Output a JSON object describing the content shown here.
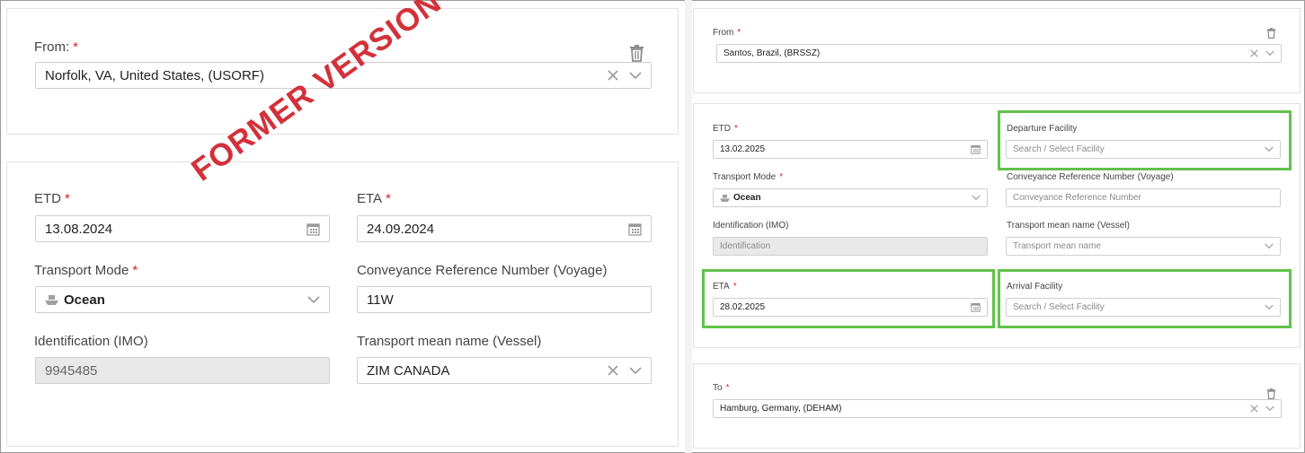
{
  "former": {
    "stamp": "FORMER VERSION",
    "from": {
      "label": "From:",
      "value": "Norfolk, VA, United States, (USORF)"
    },
    "etd": {
      "label": "ETD",
      "value": "13.08.2024"
    },
    "eta": {
      "label": "ETA",
      "value": "24.09.2024"
    },
    "transport_mode": {
      "label": "Transport Mode",
      "value": "Ocean"
    },
    "voyage": {
      "label": "Conveyance Reference Number (Voyage)",
      "value": "11W"
    },
    "imo": {
      "label": "Identification (IMO)",
      "value": "9945485"
    },
    "vessel": {
      "label": "Transport mean name (Vessel)",
      "value": "ZIM CANADA"
    }
  },
  "current": {
    "from": {
      "label": "From",
      "value": "Santos, Brazil, (BRSSZ)"
    },
    "etd": {
      "label": "ETD",
      "value": "13.02.2025"
    },
    "departure_facility": {
      "label": "Departure Facility",
      "placeholder": "Search / Select Facility"
    },
    "transport_mode": {
      "label": "Transport Mode",
      "value": "Ocean"
    },
    "voyage": {
      "label": "Conveyance Reference Number (Voyage)",
      "placeholder": "Conveyance Reference Number"
    },
    "imo": {
      "label": "Identification (IMO)",
      "placeholder": "Identification"
    },
    "vessel": {
      "label": "Transport mean name (Vessel)",
      "placeholder": "Transport mean name"
    },
    "eta": {
      "label": "ETA",
      "value": "28.02.2025"
    },
    "arrival_facility": {
      "label": "Arrival Facility",
      "placeholder": "Search / Select Facility"
    },
    "to": {
      "label": "To",
      "value": "Hamburg, Germany, (DEHAM)"
    }
  },
  "required_marker": "*",
  "icons": [
    "trash-icon",
    "clear-icon",
    "chevron-down-icon",
    "calendar-icon",
    "ship-icon"
  ],
  "colors": {
    "required": "#d0262c",
    "highlight": "#62c24a",
    "stamp": "#d3313a"
  }
}
